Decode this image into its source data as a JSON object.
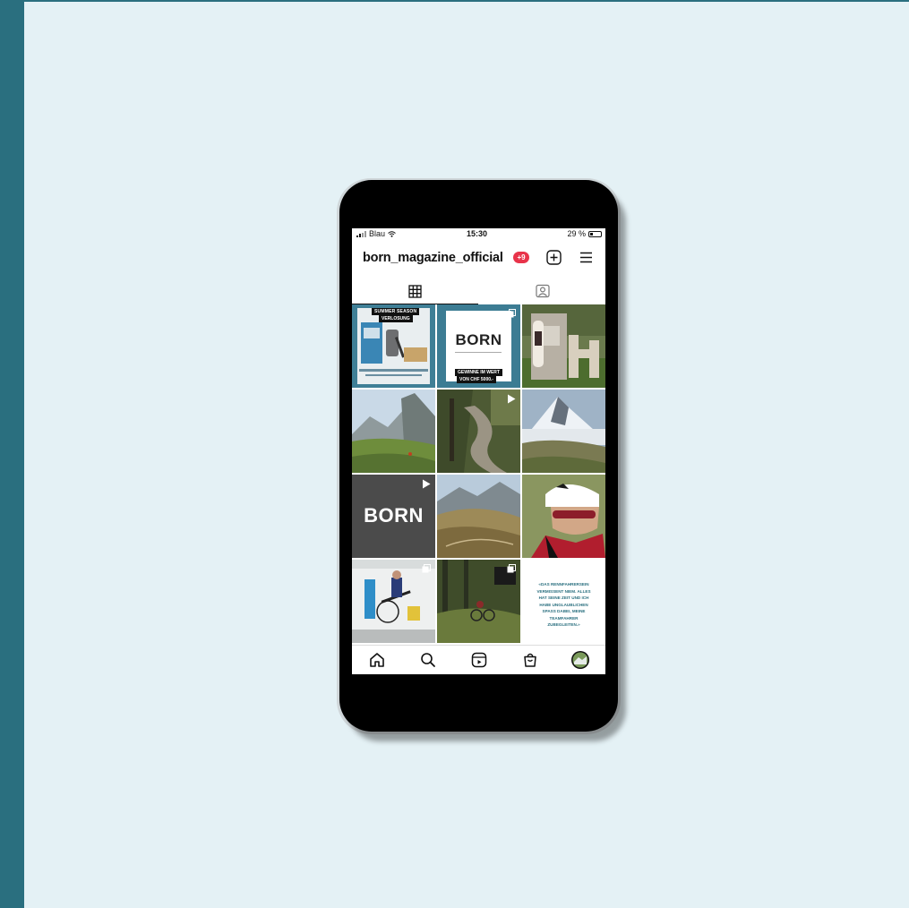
{
  "status_bar": {
    "carrier": "Blau",
    "time": "15:30",
    "battery": "29 %",
    "battery_level": 0.29
  },
  "profile": {
    "username": "born_magazine_official",
    "notification_badge": "+9"
  },
  "tabs": [
    {
      "icon": "grid-icon",
      "selected": true
    },
    {
      "icon": "tagged-person-icon",
      "selected": false
    }
  ],
  "posts": {
    "summer": {
      "title1": "SUMMER SEASON",
      "title2": "VERLOSUNG"
    },
    "born_giveaway": {
      "logo": "BORN",
      "line1": "GEWINNE IM WERT",
      "line2": "VON CHF 5000.-"
    },
    "born_video": {
      "logo": "BORN"
    },
    "quote": {
      "line1": "«DAS RENNFAHRERSEIN",
      "line2": "VERMISSENT NIEM. ALLES",
      "line3": "HAT SEINE ZEIT UND ICH",
      "line4": "HABE UNGLAUBLICHEN",
      "line5": "SPASS DABEI, MEINE",
      "line6": "TEAMFAHRER",
      "line7": "ZUBEGLEITEN.»"
    }
  },
  "bottom_nav": [
    "home-icon",
    "search-icon",
    "reels-icon",
    "shop-icon",
    "profile-avatar"
  ],
  "colors": {
    "badge": "#e8334a",
    "background": "#e4f1f5",
    "accent_bar": "#2a6f7f",
    "quote_text": "#2a6f7f"
  }
}
